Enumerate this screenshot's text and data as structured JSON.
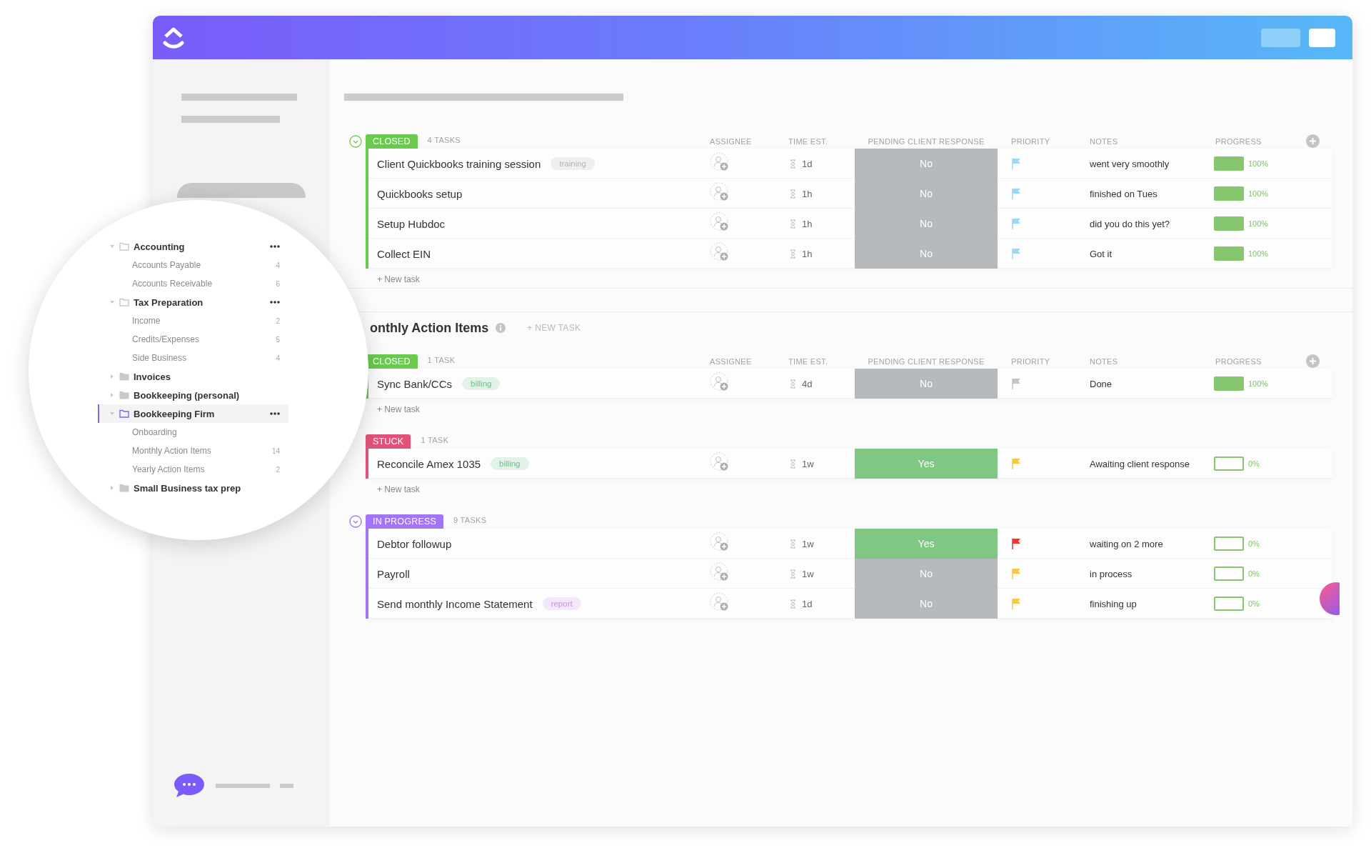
{
  "sidebar": {
    "tree": [
      {
        "label": "Accounting",
        "expanded": true,
        "selected": false,
        "children": [
          {
            "label": "Accounts Payable",
            "count": "4"
          },
          {
            "label": "Accounts Receivable",
            "count": "6"
          }
        ]
      },
      {
        "label": "Tax Preparation",
        "expanded": true,
        "selected": false,
        "children": [
          {
            "label": "Income",
            "count": "2"
          },
          {
            "label": "Credits/Expenses",
            "count": "5"
          },
          {
            "label": "Side Business",
            "count": "4"
          }
        ]
      },
      {
        "label": "Invoices",
        "expanded": false,
        "selected": false
      },
      {
        "label": "Bookkeeping (personal)",
        "expanded": false,
        "selected": false
      },
      {
        "label": "Bookkeeping Firm",
        "expanded": true,
        "selected": true,
        "children": [
          {
            "label": "Onboarding"
          },
          {
            "label": "Monthly Action Items",
            "count": "14"
          },
          {
            "label": "Yearly Action Items",
            "count": "2"
          }
        ]
      },
      {
        "label": "Small Business tax prep",
        "expanded": false,
        "selected": false
      }
    ]
  },
  "lists": [
    {
      "groups": [
        {
          "status": "CLOSED",
          "color": "#6bc950",
          "count": "4 TASKS",
          "collapsible": true,
          "columns": [
            "ASSIGNEE",
            "TIME EST.",
            "PENDING CLIENT RESPONSE",
            "PRIORITY",
            "NOTES",
            "PROGRESS"
          ],
          "new_task": "+ New task",
          "rows": [
            {
              "name": "Client Quickbooks training session",
              "tag": {
                "label": "training",
                "color": "#b4b4b4"
              },
              "time": "1d",
              "pending": {
                "label": "No",
                "on": false
              },
              "priority": {
                "color": "#9ed6f4"
              },
              "notes": "went very smoothly",
              "progress": {
                "level": 1,
                "label": "100%"
              }
            },
            {
              "name": "Quickbooks setup",
              "time": "1h",
              "pending": {
                "label": "No",
                "on": false
              },
              "priority": {
                "color": "#9ed6f4"
              },
              "notes": "finished on Tues",
              "progress": {
                "level": 1,
                "label": "100%"
              }
            },
            {
              "name": "Setup Hubdoc",
              "time": "1h",
              "pending": {
                "label": "No",
                "on": false
              },
              "priority": {
                "color": "#9ed6f4"
              },
              "notes": "did you do this yet?",
              "progress": {
                "level": 1,
                "label": "100%"
              }
            },
            {
              "name": "Collect EIN",
              "time": "1h",
              "pending": {
                "label": "No",
                "on": false
              },
              "priority": {
                "color": "#9ed6f4"
              },
              "notes": "Got it",
              "progress": {
                "level": 1,
                "label": "100%"
              }
            }
          ]
        }
      ]
    },
    {
      "title": "onthly Action Items",
      "add_label": "+ NEW TASK",
      "groups": [
        {
          "status": "CLOSED",
          "color": "#6bc950",
          "count": "1 TASK",
          "columns": [
            "ASSIGNEE",
            "TIME EST.",
            "PENDING CLIENT RESPONSE",
            "PRIORITY",
            "NOTES",
            "PROGRESS"
          ],
          "new_task": "+ New task",
          "rows": [
            {
              "name": "Sync Bank/CCs",
              "tag": {
                "label": "billing",
                "color": "#6cc48a"
              },
              "time": "4d",
              "pending": {
                "label": "No",
                "on": false
              },
              "priority": {
                "color": "#c4c4c4"
              },
              "notes": "Done",
              "progress": {
                "level": 1,
                "label": "100%"
              }
            }
          ]
        },
        {
          "status": "STUCK",
          "color": "#e0527a",
          "count": "1 TASK",
          "new_task": "+ New task",
          "rows": [
            {
              "name": "Reconcile Amex 1035",
              "tag": {
                "label": "billing",
                "color": "#6cc48a"
              },
              "time": "1w",
              "pending": {
                "label": "Yes",
                "on": true
              },
              "priority": {
                "color": "#f5c945"
              },
              "notes": "Awaiting client response",
              "progress": {
                "level": 0,
                "label": "0%"
              }
            }
          ]
        },
        {
          "status": "IN PROGRESS",
          "color": "#a175f5",
          "count": "9 TASKS",
          "collapsible": true,
          "rows": [
            {
              "name": "Debtor followup",
              "time": "1w",
              "pending": {
                "label": "Yes",
                "on": true
              },
              "priority": {
                "color": "#e03a32"
              },
              "notes": "waiting on 2 more",
              "progress": {
                "level": 0,
                "label": "0%"
              }
            },
            {
              "name": "Payroll",
              "time": "1w",
              "pending": {
                "label": "No",
                "on": false
              },
              "priority": {
                "color": "#f5c945"
              },
              "notes": "in process",
              "progress": {
                "level": 0,
                "label": "0%"
              }
            },
            {
              "name": "Send monthly Income Statement",
              "tag": {
                "label": "report",
                "color": "#c98cef"
              },
              "time": "1d",
              "pending": {
                "label": "No",
                "on": false
              },
              "priority": {
                "color": "#f5c945"
              },
              "notes": "finishing up",
              "progress": {
                "level": 0,
                "label": "0%"
              }
            }
          ]
        }
      ]
    }
  ]
}
